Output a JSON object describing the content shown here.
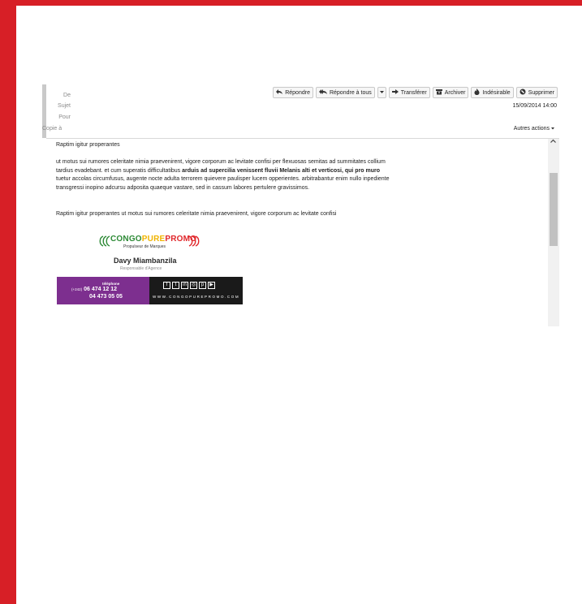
{
  "header": {
    "labels": {
      "from": "De",
      "subject": "Sujet",
      "to": "Pour",
      "cc": "Copie à"
    },
    "toolbar": {
      "reply": "Répondre",
      "reply_all": "Répondre à tous",
      "forward": "Transférer",
      "archive": "Archiver",
      "junk": "Indésirable",
      "delete": "Supprimer"
    },
    "date": "15/09/2014 14:00",
    "more_actions": "Autres actions"
  },
  "body": {
    "line1": "Raptim igitur properantes",
    "para_a1": "ut motus sui rumores celeritate nimia praevenirent, vigore corporum ac levitate confisi per flexuosas semitas ad summitates collium",
    "para_a2_pre": "tardius evadebant. et cum superatis difficultatibus ",
    "para_a2_bold": "arduis ad supercilia venissent fluvii Melanis alti et verticosi, qui pro muro",
    "para_a3": "tuetur accolas circumfusus, augente nocte adulta terrorem quievere paulisper lucem opperientes. arbitrabantur enim nullo inpediente",
    "para_a4": "transgressi inopino adcursu adposita quaeque vastare, sed in cassum labores pertulere gravissimos.",
    "line3": "Raptim igitur properantes ut motus sui rumores celeritate nimia praevenirent, vigore corporum ac levitate confisi"
  },
  "signature": {
    "logo": {
      "part1": "CONGO",
      "part2": "PURE",
      "part3": "PROMO",
      "tagline": "Propulseur de Marques"
    },
    "name": "Davy Miambanzila",
    "role": "Responsable d'Agence",
    "tel_label": "téléphone",
    "country_code": "(+242)",
    "phone1": "06 474 12 12",
    "phone2": "04 473 05 05",
    "website": "WWW.CONGOPUREPROMO.COM",
    "social_icons": [
      "facebook-icon",
      "twitter-icon",
      "linkedin-icon",
      "instagram-icon",
      "pinterest-icon",
      "youtube-icon"
    ]
  },
  "colors": {
    "frame": "#d71f26",
    "card_purple": "#7d2f8f",
    "card_dark": "#1a1a1a"
  }
}
